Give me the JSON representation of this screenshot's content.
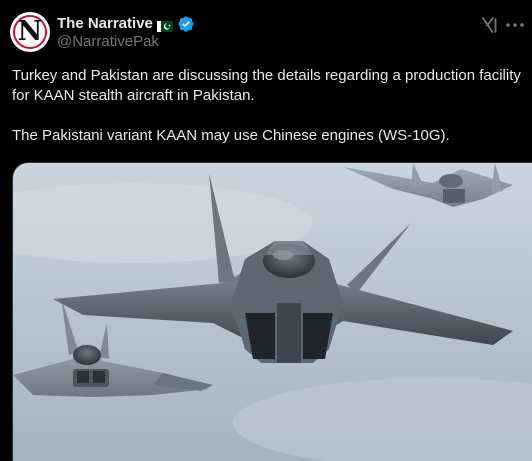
{
  "author": {
    "display_name": "The Narrative",
    "handle": "@NarrativePak",
    "avatar_letter": "N",
    "verified": true,
    "flag_icon": "pakistan-flag-icon"
  },
  "post": {
    "paragraphs": [
      "Turkey and Pakistan are discussing  the details regarding  a production facility for KAAN stealth aircraft in Pakistan.",
      "The Pakistani variant KAAN may use Chinese engines (WS-10G)."
    ]
  },
  "actions": {
    "grok_icon": "grok-icon",
    "more_icon": "more-options-icon"
  },
  "media": {
    "type": "photo",
    "subject_icon": "fighter-jets-photo"
  },
  "colors": {
    "background": "#000000",
    "text_primary": "#e7e9ea",
    "text_secondary": "#71767b",
    "verified_blue": "#1d9bf0",
    "pakistan_green": "#01411c",
    "avatar_red": "#c8102e"
  }
}
